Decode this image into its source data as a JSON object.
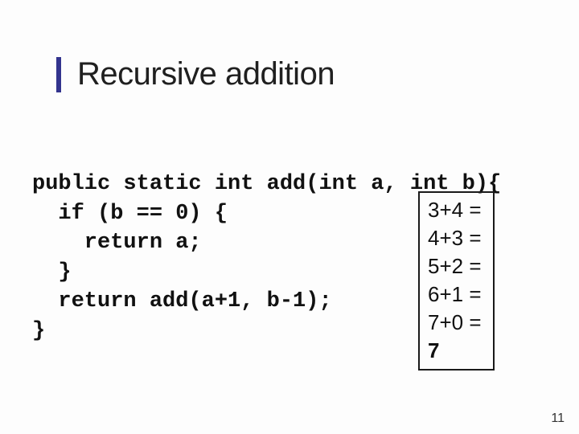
{
  "title": "Recursive addition",
  "code": {
    "l1": "public static int add(int a, int b){",
    "l2": "  if (b == 0) {",
    "l3": "    return a;",
    "l4": "  }",
    "l5": "  return add(a+1, b-1);",
    "l6": "}"
  },
  "trace": {
    "l1": "3+4 =",
    "l2": "4+3 =",
    "l3": "5+2 =",
    "l4": "6+1 =",
    "l5": "7+0 =",
    "result": "7"
  },
  "page_number": "11"
}
